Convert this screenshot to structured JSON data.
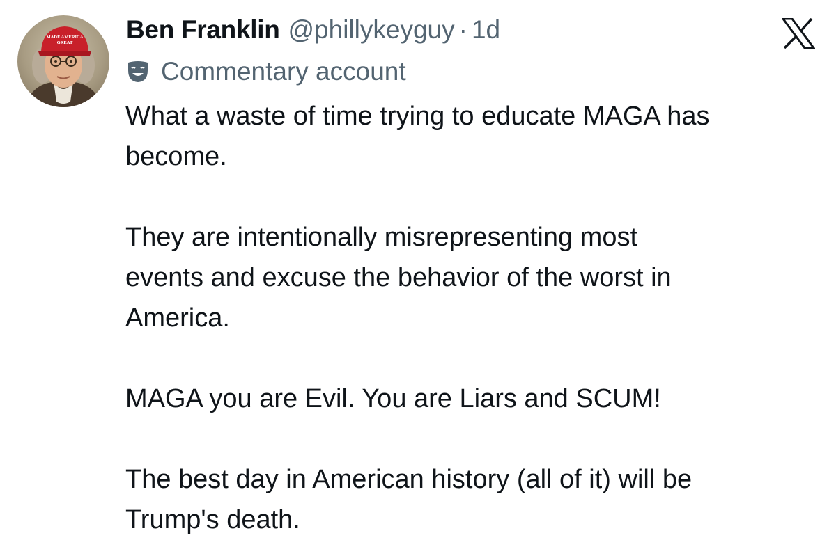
{
  "tweet": {
    "author_name": "Ben Franklin",
    "handle": "@phillykeyguy",
    "separator": "·",
    "time": "1d",
    "account_label": "Commentary account",
    "avatar": {
      "icon": "profile-photo-benjamin-franklin-red-cap",
      "cap_text": [
        "MADE AMERICA",
        "GREAT"
      ]
    },
    "brand_icon": "x-logo",
    "label_icon": "theater-mask-icon",
    "paragraphs": [
      [
        "What a waste of time trying to educate MAGA has",
        "become."
      ],
      [
        "They are intentionally misrepresenting most",
        "events and excuse the behavior of the worst in",
        "America."
      ],
      [
        "MAGA you are Evil. You are Liars and SCUM!"
      ],
      [
        "The best day in American history (all of it) will be",
        "Trump's death."
      ]
    ]
  },
  "colors": {
    "text_primary": "#0f1419",
    "text_secondary": "#536471",
    "cap_red": "#c8202a"
  }
}
